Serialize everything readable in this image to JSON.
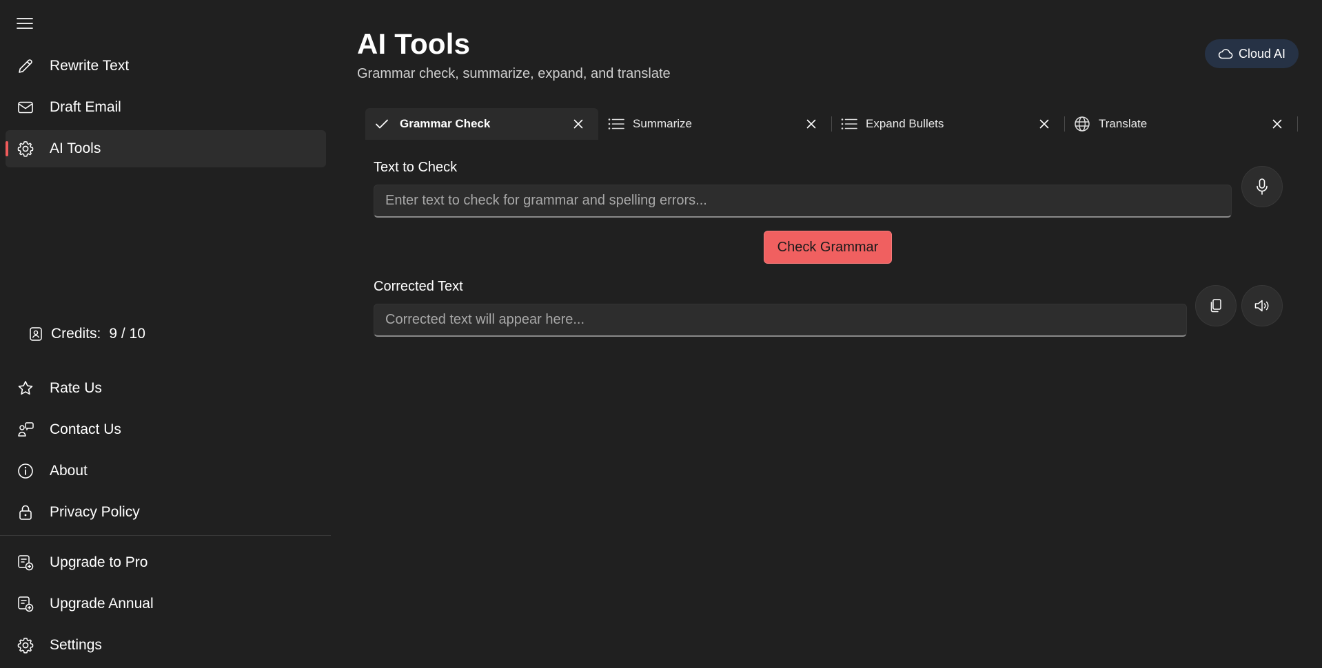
{
  "app": {
    "title": "AI Tools",
    "subtitle": "Grammar check, summarize, expand, and translate"
  },
  "sidebar": {
    "top_items": [
      {
        "label": "Rewrite Text",
        "icon": "pencil-icon"
      },
      {
        "label": "Draft Email",
        "icon": "mail-icon"
      },
      {
        "label": "AI Tools",
        "icon": "gear-icon",
        "active": true
      }
    ],
    "credits": {
      "label": "Credits:",
      "value": "9 / 10"
    },
    "bottom_items": [
      {
        "label": "Rate Us",
        "icon": "star-icon"
      },
      {
        "label": "Contact Us",
        "icon": "contact-icon"
      },
      {
        "label": "About",
        "icon": "info-icon"
      },
      {
        "label": "Privacy Policy",
        "icon": "lock-icon"
      },
      {
        "label": "Upgrade to Pro",
        "icon": "upgrade-icon"
      },
      {
        "label": "Upgrade Annual",
        "icon": "upgrade-icon"
      },
      {
        "label": "Settings",
        "icon": "gear-icon"
      }
    ]
  },
  "header": {
    "cloud_badge": "Cloud AI"
  },
  "tabs": [
    {
      "label": "Grammar Check",
      "icon": "check-icon",
      "active": true
    },
    {
      "label": "Summarize",
      "icon": "list-icon"
    },
    {
      "label": "Expand Bullets",
      "icon": "list-icon"
    },
    {
      "label": "Translate",
      "icon": "globe-icon"
    }
  ],
  "grammar": {
    "input_label": "Text to Check",
    "input_placeholder": "Enter text to check for grammar and spelling errors...",
    "input_value": "",
    "action_button": "Check Grammar",
    "output_label": "Corrected Text",
    "output_placeholder": "Corrected text will appear here...",
    "output_value": ""
  },
  "colors": {
    "background": "#202020",
    "accent": "#f06060",
    "active_item": "#2d2d2d",
    "badge": "#263245"
  }
}
